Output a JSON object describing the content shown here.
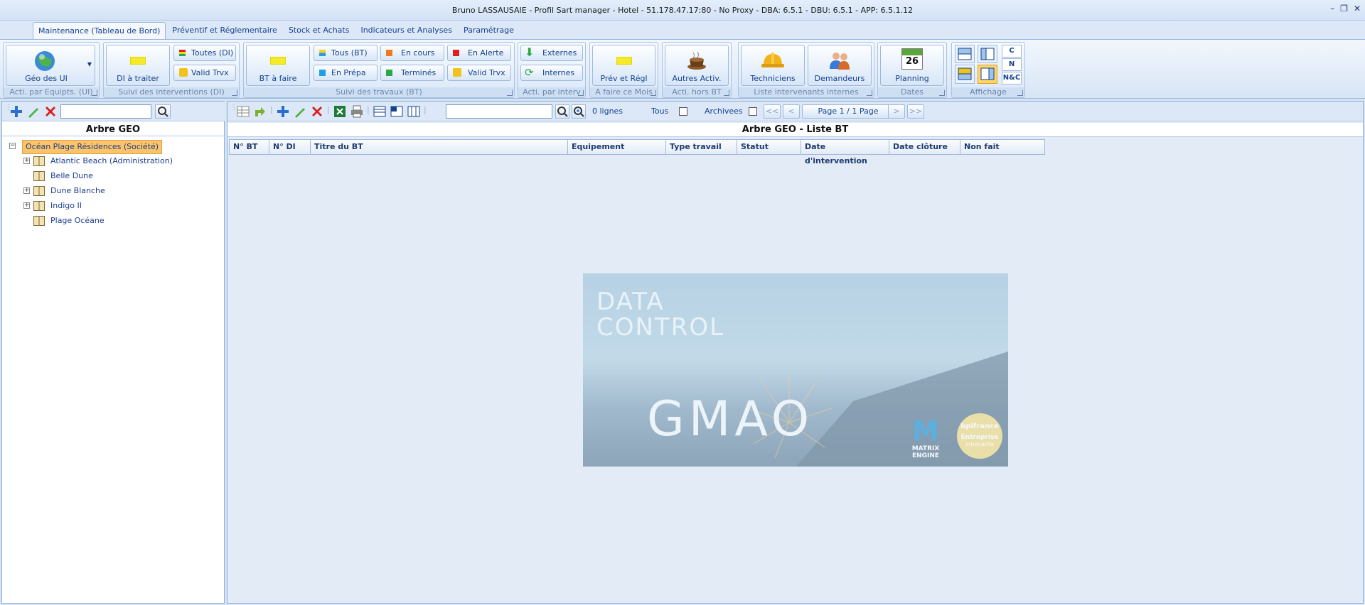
{
  "window": {
    "title": "Bruno LASSAUSAIE - Profil Sart manager - Hotel - 51.178.47.17:80 - No Proxy - DBA: 6.5.1 - DBU: 6.5.1 - APP: 6.5.1.12",
    "controls": [
      "–",
      "❐",
      "✕"
    ]
  },
  "menu": {
    "tabs": [
      {
        "label": "Maintenance (Tableau de Bord)",
        "active": true
      },
      {
        "label": "Préventif et Réglementaire"
      },
      {
        "label": "Stock et Achats"
      },
      {
        "label": "Indicateurs et Analyses"
      },
      {
        "label": "Paramétrage"
      }
    ]
  },
  "ribbon": {
    "groups": [
      {
        "caption": "Acti. par Equipts. (UI)",
        "buttons": [
          "Géo des UI"
        ]
      },
      {
        "caption": "Suivi des interventions (DI)",
        "buttons": [
          "DI à traiter",
          "Toutes (DI)",
          "Valid Trvx"
        ]
      },
      {
        "caption": "Suivi des travaux (BT)",
        "buttons": [
          "BT à faire",
          "Tous (BT)",
          "En Prépa",
          "En cours",
          "Terminés",
          "En Alerte",
          "Valid Trvx"
        ]
      },
      {
        "caption": "Acti. par interv",
        "buttons": [
          "Externes",
          "Internes"
        ]
      },
      {
        "caption": "A faire ce Mois",
        "buttons": [
          "Prév et Régl"
        ]
      },
      {
        "caption": "Acti. hors BT",
        "buttons": [
          "Autres Activ."
        ]
      },
      {
        "caption": "Liste intervenants internes",
        "buttons": [
          "Techniciens",
          "Demandeurs"
        ]
      },
      {
        "caption": "Dates",
        "buttons": [
          "Planning"
        ],
        "calendar_day": "26"
      },
      {
        "caption": "Affichage",
        "buttons": [
          "C",
          "N",
          "N&C"
        ]
      }
    ],
    "colors": {
      "tous_bt": "#f1d21c",
      "en_prepa": "#1ea0e6",
      "en_cours": "#f07a1e",
      "termines": "#2aa84a",
      "en_alerte": "#e02020"
    }
  },
  "left_pane": {
    "title": "Arbre GEO",
    "search_value": "",
    "tree": [
      {
        "label": "Océan Plage Résidences (Société)",
        "level": 0,
        "expanded": true,
        "selected": true
      },
      {
        "label": "Atlantic Beach (Administration)",
        "level": 1,
        "expandable": true
      },
      {
        "label": "Belle Dune",
        "level": 1,
        "expandable": false
      },
      {
        "label": "Dune Blanche",
        "level": 1,
        "expandable": true
      },
      {
        "label": "Indigo II",
        "level": 1,
        "expandable": true
      },
      {
        "label": "Plage Océane",
        "level": 1,
        "expandable": false
      }
    ]
  },
  "right_pane": {
    "title": "Arbre GEO - Liste BT",
    "search_value": "",
    "row_count": "0 lignes",
    "tous_label": "Tous",
    "archivees_label": "Archivees",
    "pager": {
      "first": "<<",
      "prev": "<",
      "text": "Page 1 / 1 Page",
      "next": ">",
      "last": ">>"
    },
    "columns": [
      "N° BT",
      "N° DI",
      "Titre du BT",
      "Equipement",
      "Type travail",
      "Statut",
      "Date d'intervention",
      "Date clôture",
      "Non fait"
    ]
  },
  "splash": {
    "line1": "DATA",
    "line2": "CONTROL",
    "product": "GMAO",
    "matrix_letter": "M",
    "matrix_text1": "MATRIX",
    "matrix_text2": "ENGINE",
    "bpi_text1": "bpifrance",
    "bpi_text2": "Entreprise",
    "bpi_text3": "innovante"
  }
}
